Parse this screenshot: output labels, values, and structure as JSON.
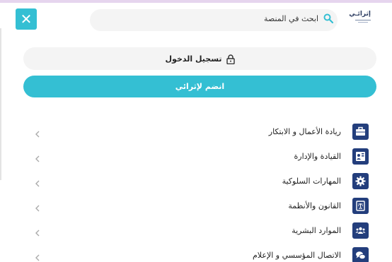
{
  "header": {
    "logo_text": "إثرائـي",
    "search_placeholder": "ابحث في المنصة",
    "close_symbol": "✕"
  },
  "auth": {
    "login_label": "تسجيل الدخول",
    "join_label": "انضم لإثرائي"
  },
  "menu": {
    "items": [
      {
        "label": "ريادة الأعمال و الابتكار",
        "icon": "briefcase-icon"
      },
      {
        "label": "القيادة والإدارة",
        "icon": "leadership-icon"
      },
      {
        "label": "المهارات السلوكية",
        "icon": "gear-icon"
      },
      {
        "label": "القانون والأنظمة",
        "icon": "law-icon"
      },
      {
        "label": "الموارد البشرية",
        "icon": "users-icon"
      },
      {
        "label": "الاتصال المؤسسي و الإعلام",
        "icon": "chat-icon"
      }
    ]
  },
  "colors": {
    "accent": "#34bfd3",
    "icon_bg": "#233e7c",
    "pill_bg": "#f4f4f4"
  }
}
